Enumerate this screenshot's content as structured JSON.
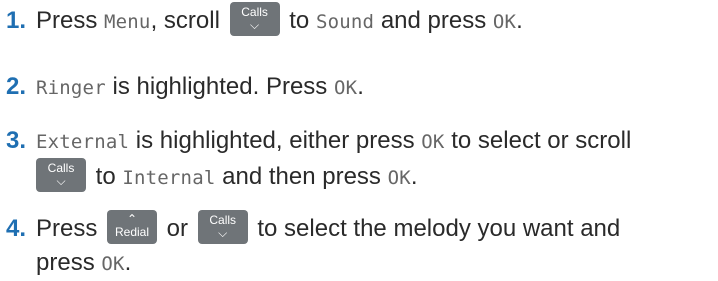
{
  "steps": [
    {
      "number": "1.",
      "parts": {
        "a": "Press ",
        "menu": "Menu",
        "b": ", scroll ",
        "c": " to ",
        "sound": "Sound",
        "d": " and press ",
        "ok": "OK",
        "e": "."
      }
    },
    {
      "number": "2.",
      "parts": {
        "ringer": "Ringer",
        "a": " is highlighted. Press ",
        "ok": "OK",
        "b": "."
      }
    },
    {
      "number": "3.",
      "parts": {
        "external": "External",
        "a": " is highlighted, either press ",
        "ok": "OK",
        "b": " to select or scroll",
        "c": " to ",
        "internal": "Internal",
        "d": " and then press ",
        "ok2": "OK",
        "e": "."
      }
    },
    {
      "number": "4.",
      "parts": {
        "a": "Press ",
        "b": " or ",
        "c": " to select the melody you want and",
        "d": "press ",
        "ok": "OK",
        "e": "."
      }
    }
  ],
  "keys": {
    "calls": {
      "label": "Calls",
      "icon": "chevron-down-icon"
    },
    "redial": {
      "label": "Redial",
      "icon": "chevron-up-icon"
    }
  }
}
